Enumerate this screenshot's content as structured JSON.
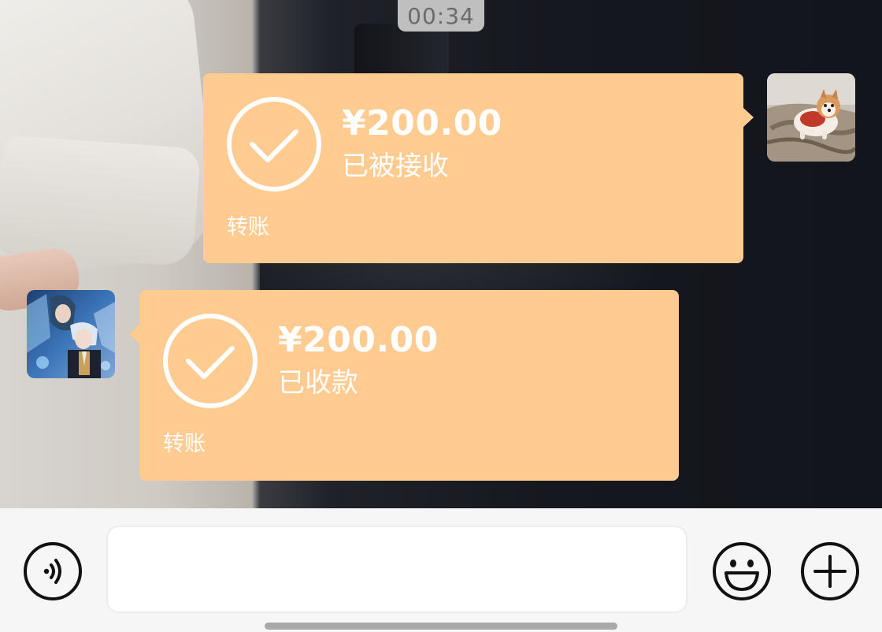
{
  "status": {
    "time": "00:34"
  },
  "messages": [
    {
      "side": "right",
      "amount": "¥200.00",
      "status_text": "已被接收",
      "type_label": "转账"
    },
    {
      "side": "left",
      "amount": "¥200.00",
      "status_text": "已收款",
      "type_label": "转账"
    }
  ],
  "input_bar": {
    "placeholder": "",
    "voice_icon": "voice-icon",
    "emoji_icon": "emoji-icon",
    "plus_icon": "plus-icon"
  },
  "colors": {
    "card_bg": "#ffcb91",
    "card_text": "#ffffff",
    "bar_bg": "#f6f6f6"
  }
}
